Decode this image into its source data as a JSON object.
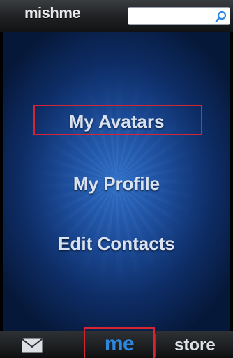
{
  "header": {
    "logo_text": "mishme",
    "search": {
      "value": "",
      "placeholder": ""
    }
  },
  "menu": {
    "items": [
      {
        "label": "My Avatars",
        "highlighted": true
      },
      {
        "label": "My Profile"
      },
      {
        "label": "Edit Contacts"
      }
    ]
  },
  "tabbar": {
    "mail_icon": "mail-icon",
    "me_label": "me",
    "store_label": "store",
    "active_tab": "me"
  },
  "colors": {
    "highlight_border": "#d32630",
    "active_tab": "#2d88de",
    "panel_blue": "#1c4d9c"
  }
}
